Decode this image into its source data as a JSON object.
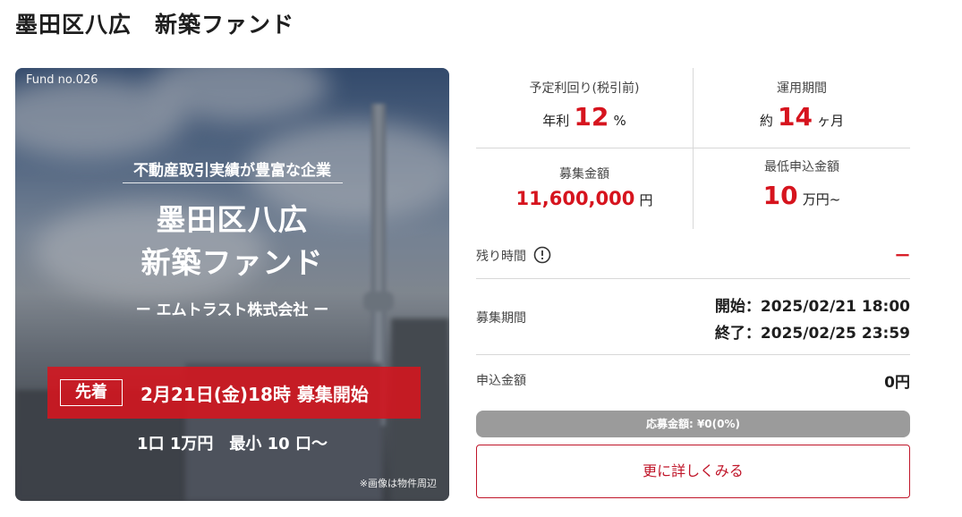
{
  "page": {
    "title": "墨田区八広　新築ファンド"
  },
  "hero": {
    "fund_no": "Fund no.026",
    "subtitle": "不動産取引実績が豊富な企業",
    "title_line1": "墨田区八広",
    "title_line2": "新築ファンド",
    "company": "ー エムトラスト株式会社 ー",
    "badge": "先着",
    "date": "2月21日(金)18時 募集開始",
    "unit": "1口 1万円　最小 10 口〜",
    "note": "※画像は物件周辺"
  },
  "stats": {
    "yield": {
      "label": "予定利回り(税引前)",
      "prefix": "年利",
      "value": "12",
      "suffix": "%"
    },
    "period": {
      "label": "運用期間",
      "prefix": "約",
      "value": "14",
      "suffix": "ヶ月"
    },
    "amount": {
      "label": "募集金額",
      "value": "11,600,000",
      "suffix": "円"
    },
    "minimum": {
      "label": "最低申込金額",
      "value": "10",
      "suffix": "万円~"
    }
  },
  "remaining": {
    "label": "残り時間",
    "value": "ー"
  },
  "recruit_period": {
    "label": "募集期間",
    "start": "開始：2025/02/21 18:00",
    "end": "終了：2025/02/25 23:59"
  },
  "applied": {
    "label": "申込金額",
    "value": "0円"
  },
  "progress": {
    "text": "応募金額: ¥0(0%)",
    "fraction": 0
  },
  "more_button": "更に詳しくみる",
  "colors": {
    "accent": "#d6141e",
    "button_border": "#c0162a",
    "progress_bg": "#9b9b9b"
  },
  "icons": {
    "remaining_time": "clock-icon"
  }
}
